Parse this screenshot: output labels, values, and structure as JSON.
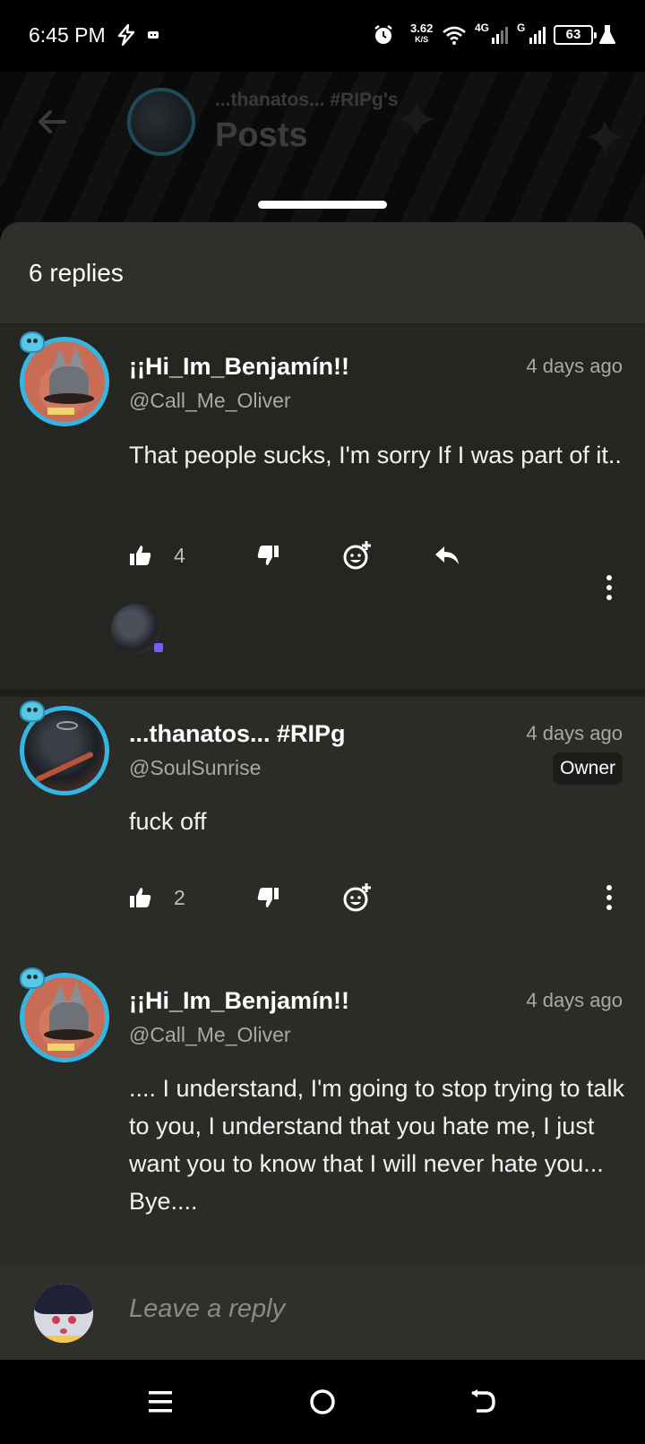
{
  "status_bar": {
    "time": "6:45 PM",
    "net_speed_value": "3.62",
    "net_speed_unit": "K/S",
    "network_4g": "4G",
    "network_g": "G",
    "battery": "63"
  },
  "header": {
    "community": "...thanatos... #RIPg's",
    "title": "Posts"
  },
  "sheet": {
    "replies_count": "6 replies"
  },
  "comments": [
    {
      "username": "¡¡Hi_Im_Benjamín!!",
      "handle": "@Call_Me_Oliver",
      "time": "4 days ago",
      "text": "That people sucks, I'm sorry If I was part of it..",
      "likes": "4"
    },
    {
      "username": "...thanatos...  #RIPg",
      "handle": "@SoulSunrise",
      "time": "4 days ago",
      "badge": "Owner",
      "text": "fuck off",
      "likes": "2"
    },
    {
      "username": "¡¡Hi_Im_Benjamín!!",
      "handle": "@Call_Me_Oliver",
      "time": "4 days ago",
      "text": ".... I understand, I'm going to stop trying to talk to you, I understand that you hate me, I just want you to know that I will never hate you... Bye...."
    }
  ],
  "reply_bar": {
    "placeholder": "Leave a reply"
  },
  "icons": {
    "like": "thumbs-up-icon",
    "dislike": "thumbs-down-icon",
    "react": "add-reaction-icon",
    "reply": "reply-arrow-icon",
    "more": "more-vertical-icon"
  }
}
